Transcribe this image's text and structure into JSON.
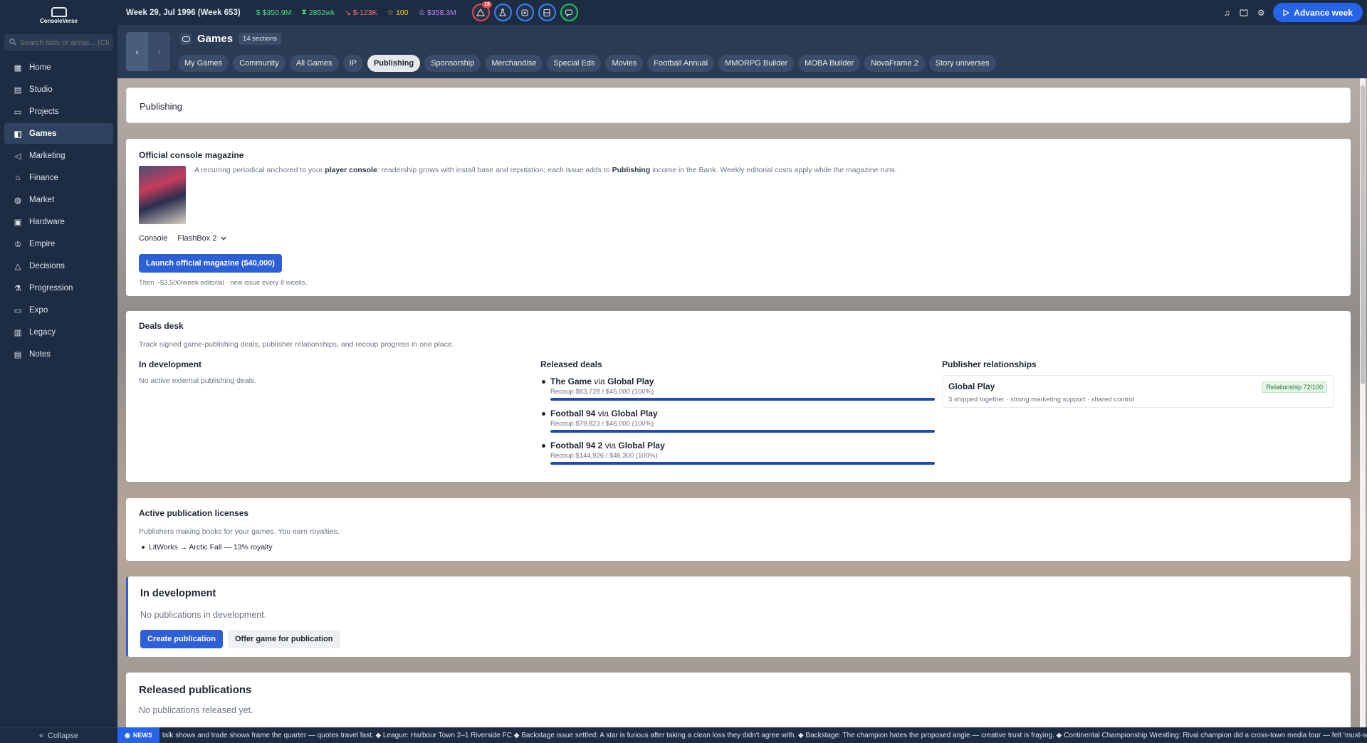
{
  "app": {
    "logo_text": "ConsoleVerse"
  },
  "sidebar": {
    "search_placeholder": "Search tabs or areas... (Ctrl+K)",
    "items": [
      {
        "label": "Home",
        "icon": "grid-icon"
      },
      {
        "label": "Studio",
        "icon": "building-icon"
      },
      {
        "label": "Projects",
        "icon": "folder-icon"
      },
      {
        "label": "Games",
        "icon": "gamepad-icon"
      },
      {
        "label": "Marketing",
        "icon": "megaphone-icon"
      },
      {
        "label": "Finance",
        "icon": "bank-icon"
      },
      {
        "label": "Market",
        "icon": "globe-icon"
      },
      {
        "label": "Hardware",
        "icon": "cpu-icon"
      },
      {
        "label": "Empire",
        "icon": "crown-icon"
      },
      {
        "label": "Decisions",
        "icon": "alert-icon"
      },
      {
        "label": "Progression",
        "icon": "flask-icon"
      },
      {
        "label": "Expo",
        "icon": "monitor-icon"
      },
      {
        "label": "Legacy",
        "icon": "book-icon"
      },
      {
        "label": "Notes",
        "icon": "notes-icon"
      }
    ],
    "active_index": 3,
    "collapse_label": "Collapse"
  },
  "topbar": {
    "week": "Week 29, Jul 1996 (Week 653)",
    "cash": "$350.9M",
    "fans": "2852wk",
    "net": "$-123K",
    "reputation": "100",
    "valuation": "$358.3M",
    "alert_count": "19",
    "colors": {
      "cash": "#4ade80",
      "fans": "#4ade80",
      "net": "#f87171",
      "reputation": "#facc15",
      "valuation": "#c084fc"
    },
    "advance_label": "Advance week"
  },
  "header": {
    "title": "Games",
    "sections_count": "14 sections",
    "tabs": [
      "My Games",
      "Community",
      "All Games",
      "IP",
      "Publishing",
      "Sponsorship",
      "Merchandise",
      "Special Eds",
      "Movies",
      "Football Annual",
      "MMORPG Builder",
      "MOBA Builder",
      "NovaFrame 2",
      "Story universes"
    ],
    "active_tab": "Publishing"
  },
  "publishing": {
    "title": "Publishing"
  },
  "magazine": {
    "title": "Official console magazine",
    "desc_prefix": "A recurring periodical anchored to your ",
    "desc_bold1": "player console",
    "desc_mid": ": readership grows with install base and reputation; each issue adds to ",
    "desc_bold2": "Publishing",
    "desc_suffix": " income in the Bank. Weekly editorial costs apply while the magazine runs.",
    "console_label": "Console",
    "console_value": "FlashBox 2",
    "launch_label": "Launch official magazine ($40,000)",
    "then_text": "Then ~$3,500/week editorial · new issue every 8 weeks."
  },
  "deals": {
    "title": "Deals desk",
    "subtitle": "Track signed game-publishing deals, publisher relationships, and recoup progress in one place.",
    "in_dev_title": "In development",
    "in_dev_empty": "No active external publishing deals.",
    "released_title": "Released deals",
    "released": [
      {
        "game": "The Game",
        "via": "via",
        "publisher": "Global Play",
        "recoup": "Recoup $83,728 / $45,000 (100%)",
        "progress": 100
      },
      {
        "game": "Football 94",
        "via": "via",
        "publisher": "Global Play",
        "recoup": "Recoup $79,823 / $46,000 (100%)",
        "progress": 100
      },
      {
        "game": "Football 94 2",
        "via": "via",
        "publisher": "Global Play",
        "recoup": "Recoup $144,926 / $46,300 (100%)",
        "progress": 100
      }
    ],
    "relationships_title": "Publisher relationships",
    "relationship": {
      "name": "Global Play",
      "details": "3 shipped together · strong marketing support · shared control",
      "badge": "Relationship 72/100"
    }
  },
  "licenses": {
    "title": "Active publication licenses",
    "subtitle": "Publishers making books for your games. You earn royalties.",
    "items": [
      "LitWorks → Arctic Fall — 13% royalty"
    ]
  },
  "in_development": {
    "title": "In development",
    "empty": "No publications in development.",
    "create_label": "Create publication",
    "offer_label": "Offer game for publication"
  },
  "released_publications": {
    "title": "Released publications",
    "empty": "No publications released yet."
  },
  "ticker": {
    "tag": "NEWS",
    "text": "talk shows and trade shows frame the quarter — quotes travel fast. ◆ League: Harbour Town 2–1 Riverside FC ◆ Backstage issue settled: A star is furious after taking a clean loss they didn't agree with. ◆ Backstage: The champion hates the proposed angle — creative trust is fraying. ◆ Continental Championship Wrestling: Rival champion did a cross-town media tour — felt 'must-see'. ◆ He"
  }
}
